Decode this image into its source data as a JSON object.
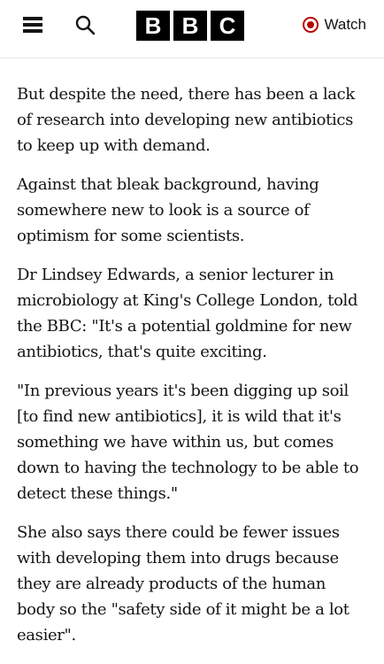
{
  "header": {
    "logo_letters": [
      "B",
      "B",
      "C"
    ],
    "watch_label": "Watch",
    "accent_color": "#b80000",
    "icons": [
      "menu-icon",
      "search-icon",
      "live-dot-icon"
    ]
  },
  "article": {
    "paragraphs": [
      "But despite the need, there has been a lack of research into developing new antibiotics to keep up with demand.",
      "Against that bleak background, having somewhere new to look is a source of optimism for some scientists.",
      "Dr Lindsey Edwards, a senior lecturer in microbiology at King's College London, told the BBC: \"It's a potential goldmine for new antibiotics, that's quite exciting.",
      "\"In previous years it's been digging up soil [to find new antibiotics], it is wild that it's something we have within us, but comes down to having the technology to be able to detect these things.\"",
      "She also says there could be fewer issues with developing them into drugs because they are already products of the human body so the \"safety side of it might be a lot easier\"."
    ]
  }
}
